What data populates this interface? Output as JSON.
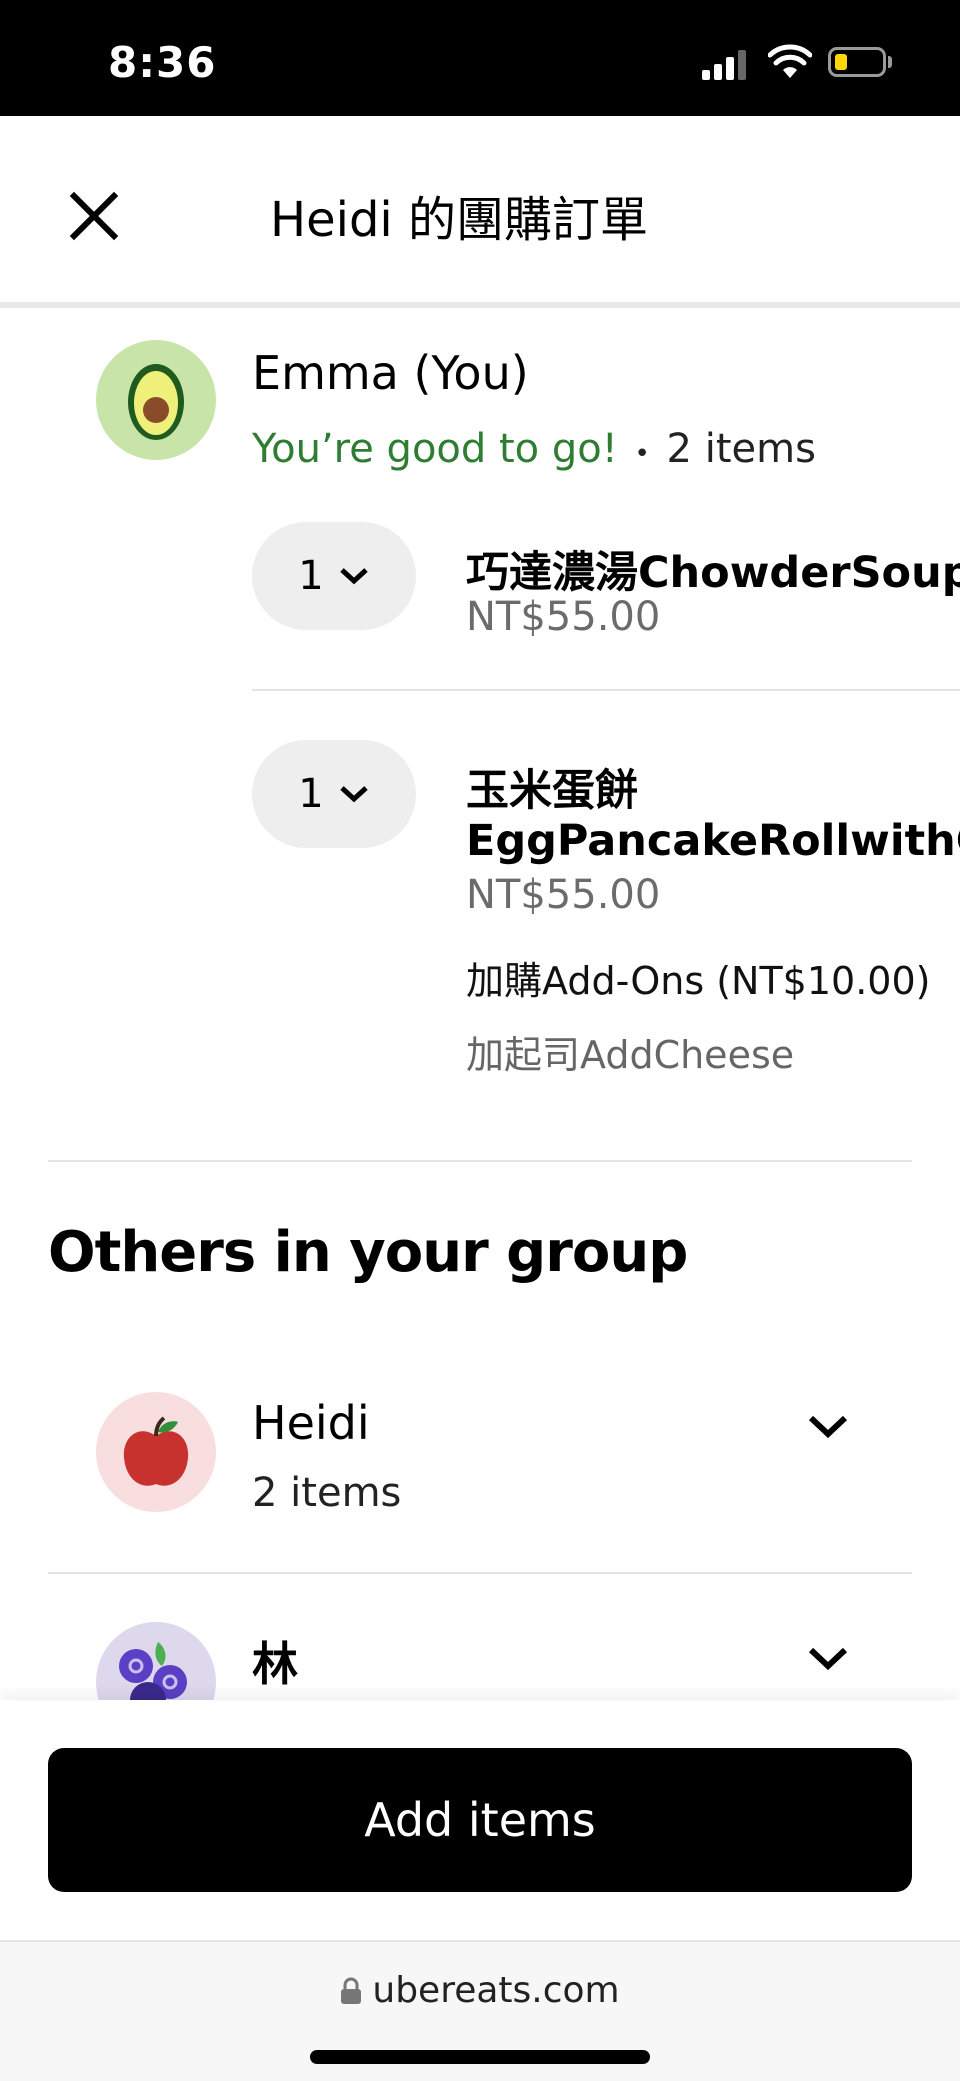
{
  "status_bar": {
    "time": "8:36"
  },
  "header": {
    "title": "Heidi 的團購訂單"
  },
  "me": {
    "name": "Emma (You)",
    "status": "You’re good to go!",
    "separator": "•",
    "count": "2 items",
    "items": [
      {
        "qty": "1",
        "name": "巧達濃湯ChowderSoup",
        "price": "NT$55.00"
      },
      {
        "qty": "1",
        "name_line1": "玉米蛋餅",
        "name_line2": "EggPancakeRollwithCo",
        "price": "NT$55.00",
        "addon_group": "加購Add-Ons (NT$10.00)",
        "addon": "加起司AddCheese"
      }
    ]
  },
  "others": {
    "title": "Others in your group",
    "members": [
      {
        "name": "Heidi",
        "count": "2 items"
      },
      {
        "name": "林"
      }
    ]
  },
  "cta": {
    "add_items": "Add items"
  },
  "browser": {
    "url": "ubereats.com"
  }
}
